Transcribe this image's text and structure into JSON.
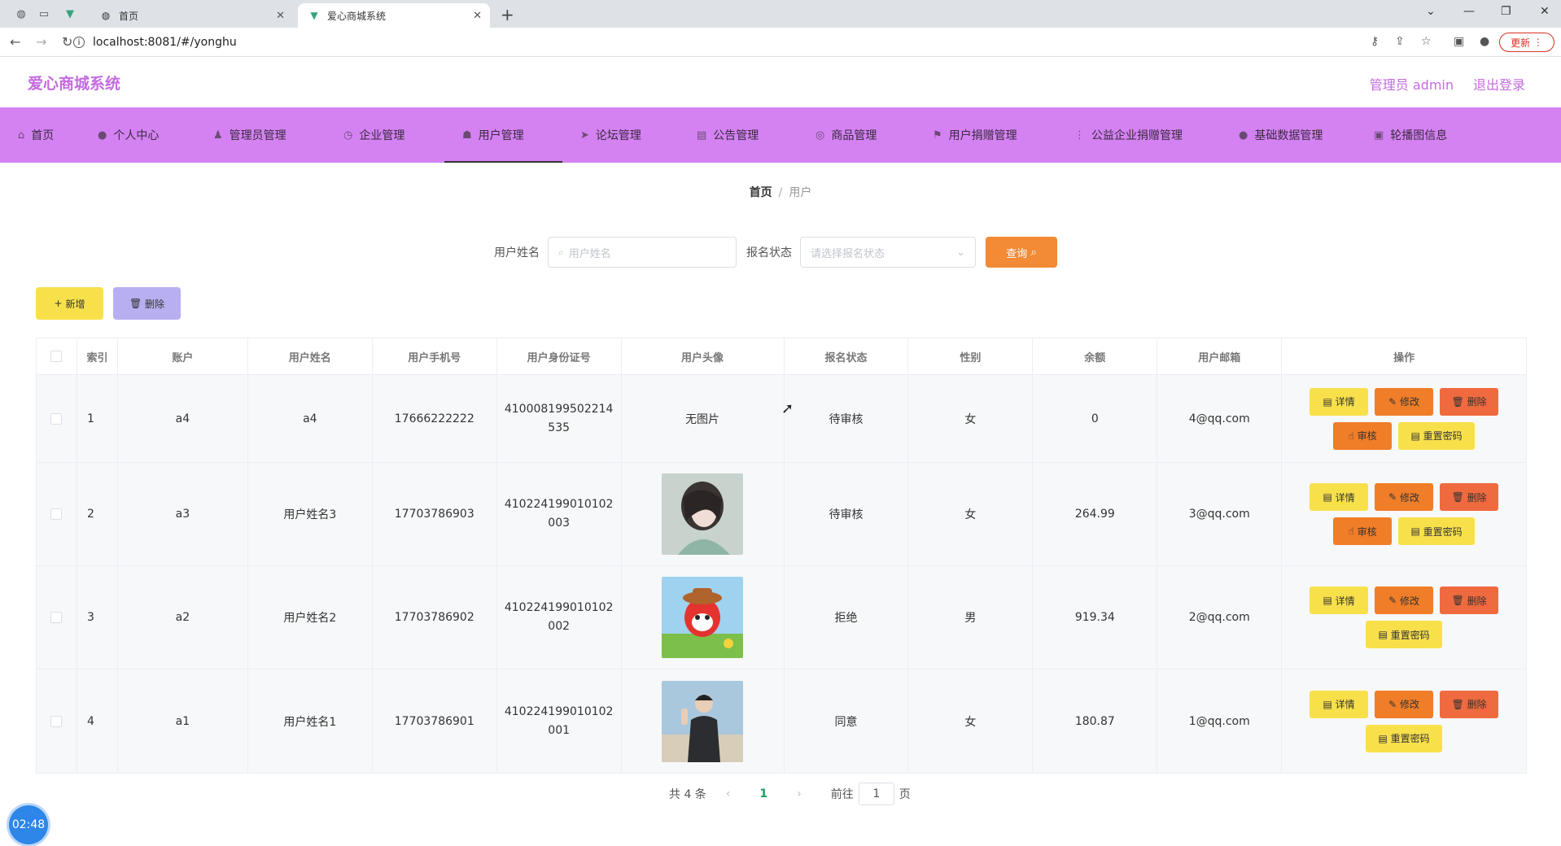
{
  "browser": {
    "tabs": [
      {
        "title": "首页"
      },
      {
        "title": "爱心商城系统"
      }
    ],
    "url": "localhost:8081/#/yonghu",
    "update_label": "更新"
  },
  "header": {
    "brand": "爱心商城系统",
    "admin": "管理员 admin",
    "logout": "退出登录"
  },
  "nav": [
    {
      "label": "首页",
      "icon": "home-icon"
    },
    {
      "label": "个人中心",
      "icon": "user-icon"
    },
    {
      "label": "管理员管理",
      "icon": "admin-icon"
    },
    {
      "label": "企业管理",
      "icon": "clock-icon"
    },
    {
      "label": "用户管理",
      "icon": "users-icon"
    },
    {
      "label": "论坛管理",
      "icon": "send-icon"
    },
    {
      "label": "公告管理",
      "icon": "notice-icon"
    },
    {
      "label": "商品管理",
      "icon": "goods-icon"
    },
    {
      "label": "用户捐赠管理",
      "icon": "flag-icon"
    },
    {
      "label": "公益企业捐赠管理",
      "icon": "list-icon"
    },
    {
      "label": "基础数据管理",
      "icon": "data-icon"
    },
    {
      "label": "轮播图信息",
      "icon": "image-icon"
    }
  ],
  "breadcrumb": {
    "home": "首页",
    "sep": "/",
    "current": "用户"
  },
  "search": {
    "name_label": "用户姓名",
    "name_placeholder": "用户姓名",
    "status_label": "报名状态",
    "status_placeholder": "请选择报名状态",
    "query_label": "查询"
  },
  "actions": {
    "add": "新增",
    "delete": "删除"
  },
  "table": {
    "headers": [
      "索引",
      "账户",
      "用户姓名",
      "用户手机号",
      "用户身份证号",
      "用户头像",
      "报名状态",
      "性别",
      "余额",
      "用户邮箱",
      "操作"
    ],
    "no_image": "无图片",
    "rows": [
      {
        "index": "1",
        "account": "a4",
        "name": "a4",
        "phone": "17666222222",
        "id": "410008199502214535",
        "avatar": "none",
        "status": "待审核",
        "gender": "女",
        "balance": "0",
        "email": "4@qq.com"
      },
      {
        "index": "2",
        "account": "a3",
        "name": "用户姓名3",
        "phone": "17703786903",
        "id": "410224199010102003",
        "avatar": "girl",
        "status": "待审核",
        "gender": "女",
        "balance": "264.99",
        "email": "3@qq.com"
      },
      {
        "index": "3",
        "account": "a2",
        "name": "用户姓名2",
        "phone": "17703786902",
        "id": "410224199010102002",
        "avatar": "cartoon",
        "status": "拒绝",
        "gender": "男",
        "balance": "919.34",
        "email": "2@qq.com"
      },
      {
        "index": "4",
        "account": "a1",
        "name": "用户姓名1",
        "phone": "17703786901",
        "id": "410224199010102001",
        "avatar": "boy",
        "status": "同意",
        "gender": "女",
        "balance": "180.87",
        "email": "1@qq.com"
      }
    ],
    "ops": {
      "detail": "详情",
      "edit": "修改",
      "delete": "删除",
      "audit": "审核",
      "reset": "重置密码"
    }
  },
  "pager": {
    "total": "共 4 条",
    "page": "1",
    "goto": "前往",
    "goto_value": "1",
    "unit": "页"
  },
  "clock": "02:48"
}
